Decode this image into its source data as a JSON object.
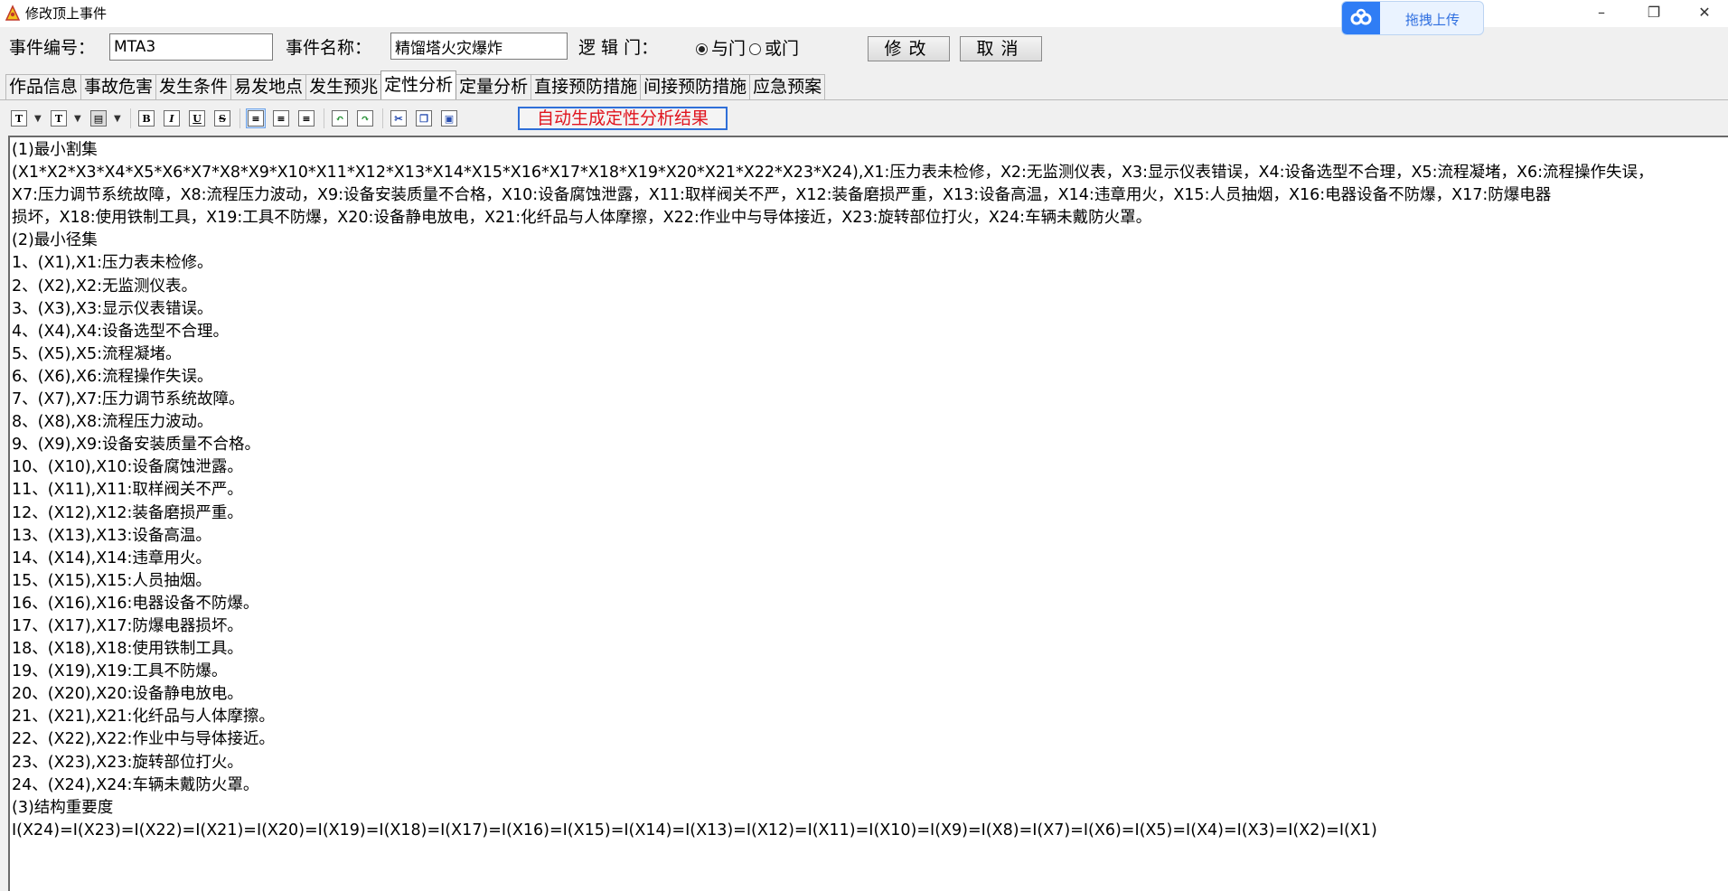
{
  "window": {
    "title": "修改顶上事件",
    "upload_label": "拖拽上传",
    "minimize": "–",
    "maximize": "❐",
    "close": "✕"
  },
  "header": {
    "id_label": "事件编号：",
    "id_value": "MTA3",
    "name_label": "事件名称：",
    "name_value": "精馏塔火灾爆炸",
    "logic_label": "逻 辑 门：",
    "and_gate": "与门",
    "or_gate": "或门",
    "modify_button": "修改",
    "cancel_button": "取消"
  },
  "tabs": [
    "作品信息",
    "事故危害",
    "发生条件",
    "易发地点",
    "发生预兆",
    "定性分析",
    "定量分析",
    "直接预防措施",
    "间接预防措施",
    "应急预案"
  ],
  "active_tab": 5,
  "toolbar": {
    "auto_button": "自动生成定性分析结果"
  },
  "content_lines": [
    "(1)最小割集",
    "(X1*X2*X3*X4*X5*X6*X7*X8*X9*X10*X11*X12*X13*X14*X15*X16*X17*X18*X19*X20*X21*X22*X23*X24),X1:压力表未检修，X2:无监测仪表，X3:显示仪表错误，X4:设备选型不合理，X5:流程凝堵，X6:流程操作失误，",
    "X7:压力调节系统故障，X8:流程压力波动，X9:设备安装质量不合格，X10:设备腐蚀泄露，X11:取样阀关不严，X12:装备磨损严重，X13:设备高温，X14:违章用火，X15:人员抽烟，X16:电器设备不防爆，X17:防爆电器",
    "损坏，X18:使用铁制工具，X19:工具不防爆，X20:设备静电放电，X21:化纤品与人体摩擦，X22:作业中与导体接近，X23:旋转部位打火，X24:车辆未戴防火罩。",
    "(2)最小径集",
    "1、(X1),X1:压力表未检修。",
    "2、(X2),X2:无监测仪表。",
    "3、(X3),X3:显示仪表错误。",
    "4、(X4),X4:设备选型不合理。",
    "5、(X5),X5:流程凝堵。",
    "6、(X6),X6:流程操作失误。",
    "7、(X7),X7:压力调节系统故障。",
    "8、(X8),X8:流程压力波动。",
    "9、(X9),X9:设备安装质量不合格。",
    "10、(X10),X10:设备腐蚀泄露。",
    "11、(X11),X11:取样阀关不严。",
    "12、(X12),X12:装备磨损严重。",
    "13、(X13),X13:设备高温。",
    "14、(X14),X14:违章用火。",
    "15、(X15),X15:人员抽烟。",
    "16、(X16),X16:电器设备不防爆。",
    "17、(X17),X17:防爆电器损坏。",
    "18、(X18),X18:使用铁制工具。",
    "19、(X19),X19:工具不防爆。",
    "20、(X20),X20:设备静电放电。",
    "21、(X21),X21:化纤品与人体摩擦。",
    "22、(X22),X22:作业中与导体接近。",
    "23、(X23),X23:旋转部位打火。",
    "24、(X24),X24:车辆未戴防火罩。",
    "(3)结构重要度",
    "I(X24)=I(X23)=I(X22)=I(X21)=I(X20)=I(X19)=I(X18)=I(X17)=I(X16)=I(X15)=I(X14)=I(X13)=I(X12)=I(X11)=I(X10)=I(X9)=I(X8)=I(X7)=I(X6)=I(X5)=I(X4)=I(X3)=I(X2)=I(X1)"
  ]
}
